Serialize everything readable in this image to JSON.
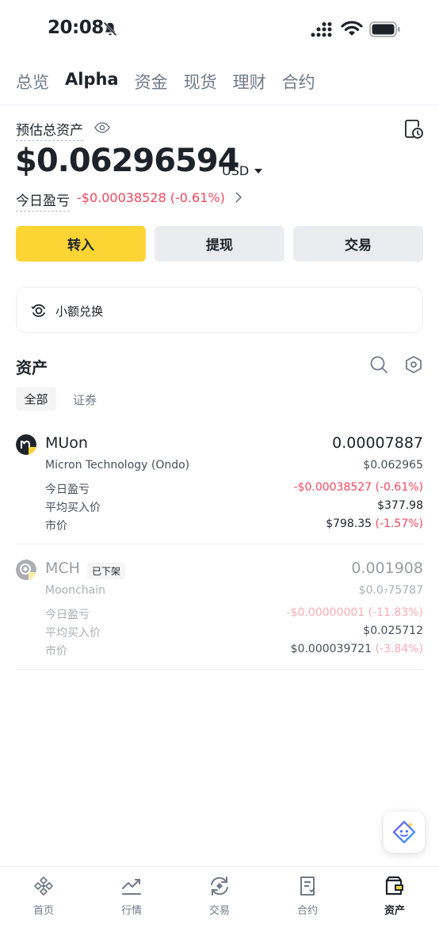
{
  "status_bar": {
    "time": "20:08"
  },
  "top_tabs": [
    "总览",
    "Alpha",
    "资金",
    "现货",
    "理财",
    "合约"
  ],
  "overview": {
    "est_label": "预估总资产",
    "balance": "$0.06296594",
    "currency": "USD",
    "pnl_label": "今日盈亏",
    "pnl_value": "-$0.00038528 (-0.61%)"
  },
  "actions": {
    "deposit": "转入",
    "withdraw": "提现",
    "trade": "交易"
  },
  "convert": {
    "label": "小额兑换"
  },
  "assets": {
    "title": "资产",
    "filters": {
      "all": "全部",
      "securities": "证券"
    },
    "row_labels": {
      "pnl": "今日盈亏",
      "avg_price": "平均买入价",
      "market_price": "市价"
    },
    "items": [
      {
        "symbol": "MUon",
        "name": "Micron Technology (Ondo)",
        "quantity": "0.00007887",
        "value": "$0.062965",
        "pnl": "-$0.00038527 (-0.61%)",
        "avg_price": "$377.98",
        "price": "$798.35",
        "price_change": "(-1.57%)"
      },
      {
        "symbol": "MCH",
        "tag": "已下架",
        "name": "Moonchain",
        "quantity": "0.001908",
        "value": "$0.0₇75787",
        "pnl": "-$0.00000001 (-11.83%)",
        "avg_price": "$0.025712",
        "price": "$0.000039721",
        "price_change": "(-3.84%)"
      }
    ]
  },
  "bottom_nav": [
    "首页",
    "行情",
    "交易",
    "合约",
    "资产"
  ],
  "colors": {
    "accent": "#fcd535",
    "negative": "#f6465d",
    "text": "#1e2329",
    "muted": "#707a8a"
  }
}
